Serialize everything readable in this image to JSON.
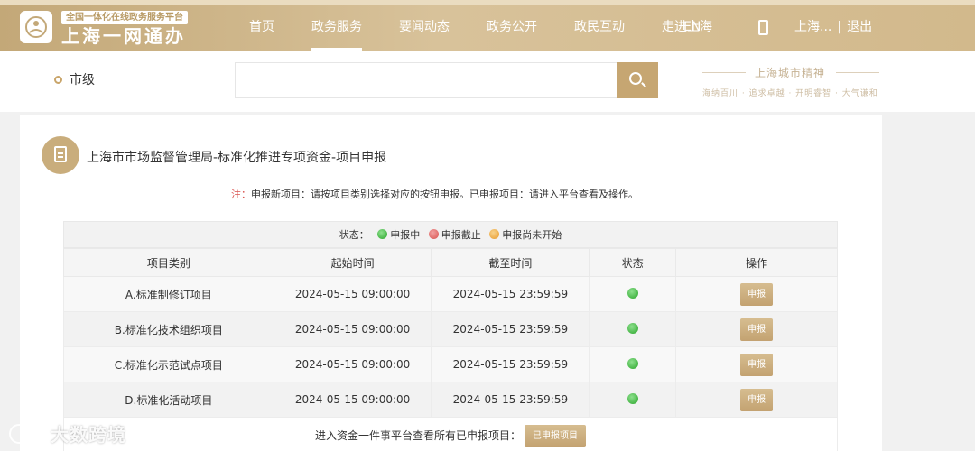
{
  "header": {
    "logo_subtitle": "全国一体化在线政务服务平台",
    "logo_title": "上海一网通办",
    "nav": [
      {
        "label": "首页",
        "active": false
      },
      {
        "label": "政务服务",
        "active": true
      },
      {
        "label": "要闻动态",
        "active": false
      },
      {
        "label": "政务公开",
        "active": false
      },
      {
        "label": "政民互动",
        "active": false
      },
      {
        "label": "走进上海",
        "active": false
      }
    ],
    "lang": "EN",
    "user": "上海...",
    "logout": "退出",
    "icons": {
      "logo": "shanghai-seal-icon",
      "phone": "mobile-phone-icon"
    }
  },
  "search": {
    "region": "市级",
    "placeholder": "",
    "value": "",
    "brand_title": "上海城市精神",
    "brand_tags": "海纳百川 · 追求卓越 · 开明睿智 · 大气谦和"
  },
  "card": {
    "title": "上海市市场监督管理局-标准化推进专项资金-项目申报",
    "note_prefix": "注：",
    "note_text": "申报新项目：请按项目类别选择对应的按钮申报。已申报项目：请进入平台查看及操作。",
    "legend": {
      "label": "状态：",
      "items": [
        {
          "label": "申报中",
          "color": "#2aa52a"
        },
        {
          "label": "申报截止",
          "color": "#d9534f"
        },
        {
          "label": "申报尚未开始",
          "color": "#e89a2c"
        }
      ]
    },
    "table": {
      "headers": [
        "项目类别",
        "起始时间",
        "截至时间",
        "状态",
        "操作"
      ],
      "rows": [
        {
          "category": "A.标准制修订项目",
          "start": "2024-05-15 09:00:00",
          "end": "2024-05-15 23:59:59",
          "status": "申报中",
          "action": "申报"
        },
        {
          "category": "B.标准化技术组织项目",
          "start": "2024-05-15 09:00:00",
          "end": "2024-05-15 23:59:59",
          "status": "申报中",
          "action": "申报"
        },
        {
          "category": "C.标准化示范试点项目",
          "start": "2024-05-15 09:00:00",
          "end": "2024-05-15 23:59:59",
          "status": "申报中",
          "action": "申报"
        },
        {
          "category": "D.标准化活动项目",
          "start": "2024-05-15 09:00:00",
          "end": "2024-05-15 23:59:59",
          "status": "申报中",
          "action": "申报"
        }
      ]
    },
    "footer_text": "进入资金一件事平台查看所有已申报项目：",
    "footer_button": "已申报项目"
  },
  "watermark": "大数跨境",
  "colors": {
    "gold": "#c6a672",
    "active_status": "#2aa52a"
  }
}
